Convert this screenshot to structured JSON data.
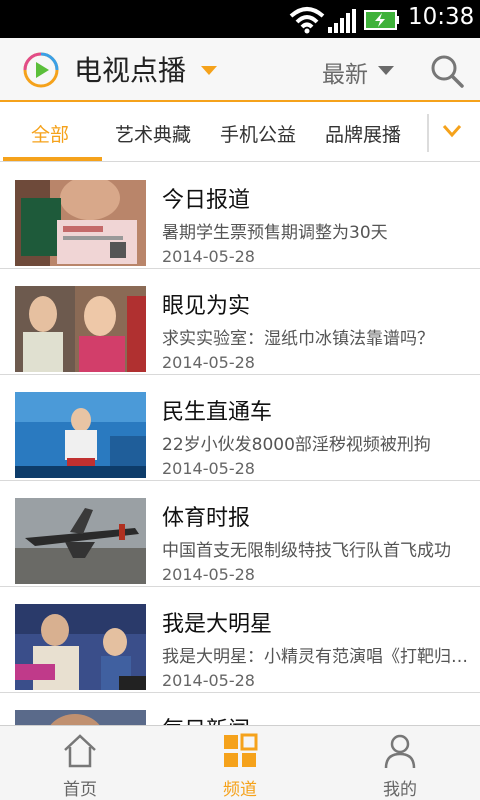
{
  "status_bar": {
    "time": "10:38"
  },
  "header": {
    "title": "电视点播",
    "sort_label": "最新"
  },
  "tabs": [
    {
      "label": "全部"
    },
    {
      "label": "艺术典藏"
    },
    {
      "label": "手机公益"
    },
    {
      "label": "品牌展播"
    }
  ],
  "list": [
    {
      "title": "今日报道",
      "desc": "暑期学生票预售期调整为30天",
      "date": "2014-05-28"
    },
    {
      "title": "眼见为实",
      "desc": "求实实验室：湿纸巾冰镇法靠谱吗？",
      "date": "2014-05-28"
    },
    {
      "title": "民生直通车",
      "desc": "22岁小伙发8000部淫秽视频被刑拘",
      "date": "2014-05-28"
    },
    {
      "title": "体育时报",
      "desc": "中国首支无限制级特技飞行队首飞成功",
      "date": "2014-05-28"
    },
    {
      "title": "我是大明星",
      "desc": "我是大明星：小精灵有范演唱《打靶归…",
      "date": "2014-05-28"
    },
    {
      "title": "每日新闻",
      "desc": "",
      "date": ""
    }
  ],
  "bottom_nav": [
    {
      "label": "首页"
    },
    {
      "label": "频道"
    },
    {
      "label": "我的"
    }
  ],
  "colors": {
    "accent": "#f5a21b",
    "status_bar": "#000000",
    "battery": "#3fb23a"
  }
}
